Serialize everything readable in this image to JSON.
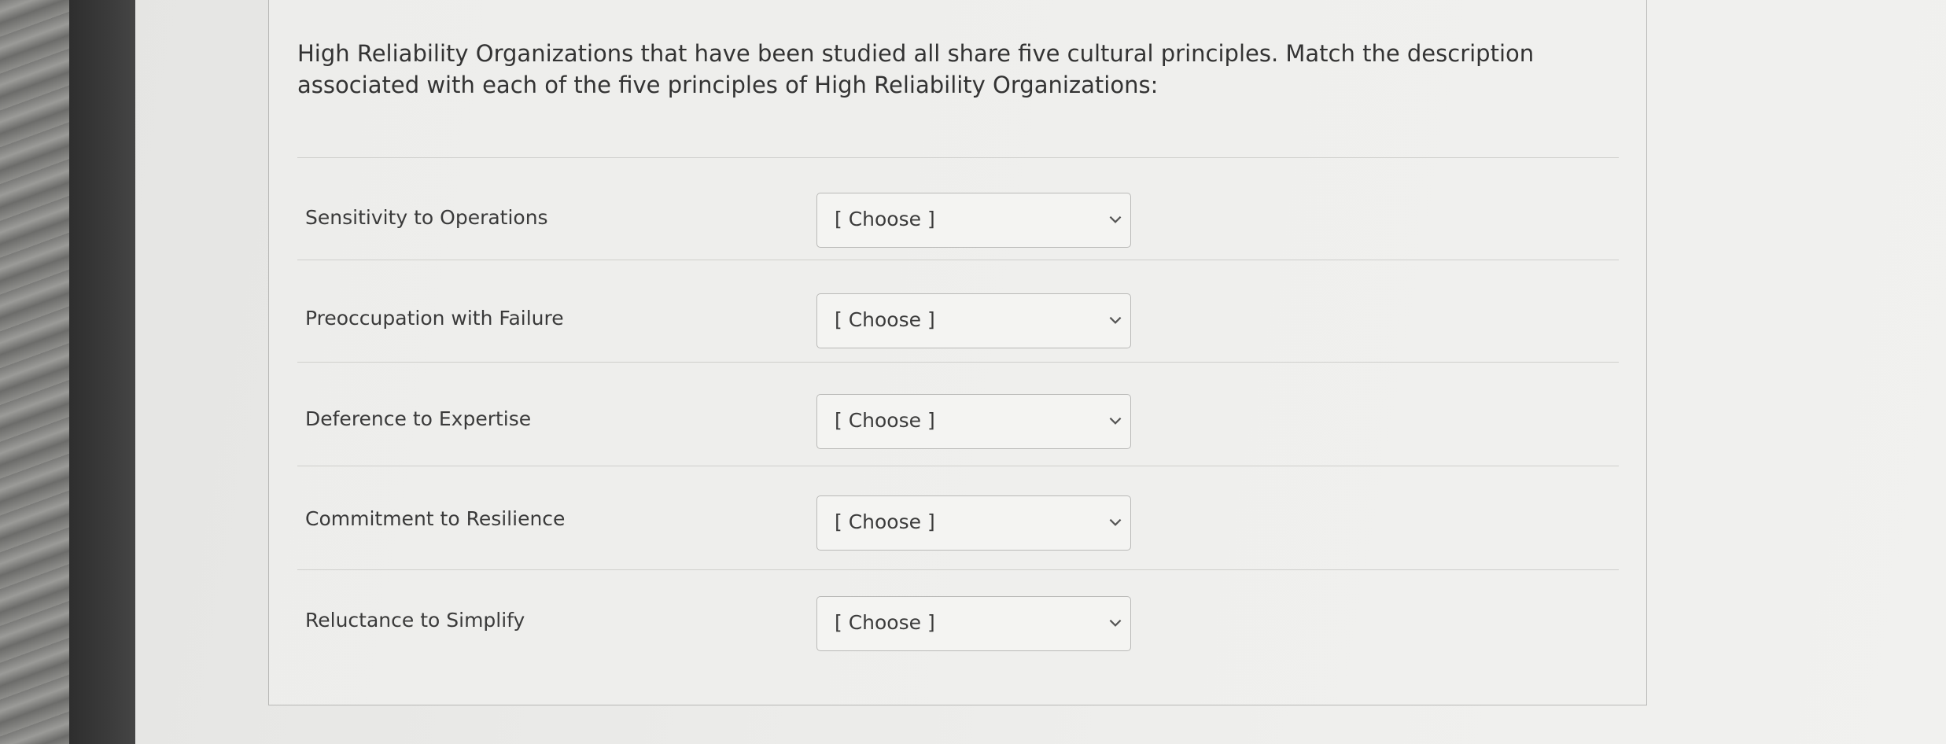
{
  "question": {
    "prompt": "High Reliability Organizations that have been studied all share five cultural principles.  Match the description associated with each of the five principles of High Reliability Organizations:"
  },
  "rows": [
    {
      "label": "Sensitivity to Operations",
      "select_value": "[ Choose ]"
    },
    {
      "label": "Preoccupation with Failure",
      "select_value": "[ Choose ]"
    },
    {
      "label": "Deference to Expertise",
      "select_value": "[ Choose ]"
    },
    {
      "label": "Commitment to Resilience",
      "select_value": "[ Choose ]"
    },
    {
      "label": "Reluctance to Simplify",
      "select_value": "[ Choose ]"
    }
  ],
  "icons": {
    "dropdown": "chevron-down-icon"
  },
  "colors": {
    "text": "#333333",
    "border": "#b9b9b7",
    "background": "#efefed"
  }
}
